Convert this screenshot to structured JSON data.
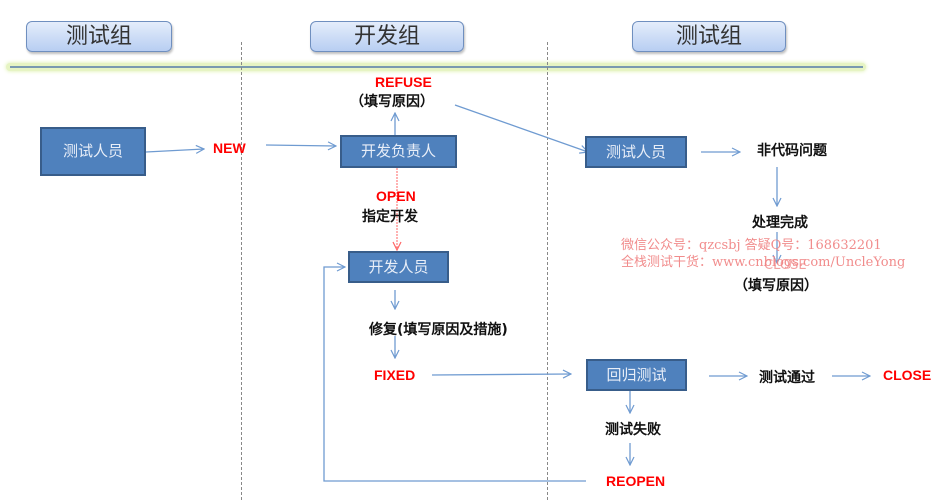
{
  "lanes": [
    {
      "title": "测试组"
    },
    {
      "title": "开发组"
    },
    {
      "title": "测试组"
    }
  ],
  "nodes": {
    "tester": "测试人员",
    "dev_lead": "开发负责人",
    "developer": "开发人员",
    "tester_right": "测试人员",
    "regression": "回归测试"
  },
  "labels": {
    "new": "NEW",
    "refuse": "REFUSE",
    "refuse_reason": "（填写原因）",
    "open": "OPEN",
    "assign_dev": "指定开发",
    "fix": "修复(填写原因及措施)",
    "fixed": "FIXED",
    "non_code_issue": "非代码问题",
    "handled": "处理完成",
    "close_faded": "CLOSE",
    "close_reason": "（填写原因）",
    "test_passed": "测试通过",
    "close": "CLOSE",
    "test_failed": "测试失败",
    "reopen": "REOPEN"
  },
  "watermark": {
    "line1": "微信公众号：qzcsbj   答疑Q号：168632201",
    "line2": "全栈测试干货：www.cnblogs.com/UncleYong"
  },
  "colors": {
    "node_fill": "#4f81bd",
    "state_red": "#ff0000",
    "arrow_blue": "#6f9bd1",
    "watermark": "#f08080"
  }
}
